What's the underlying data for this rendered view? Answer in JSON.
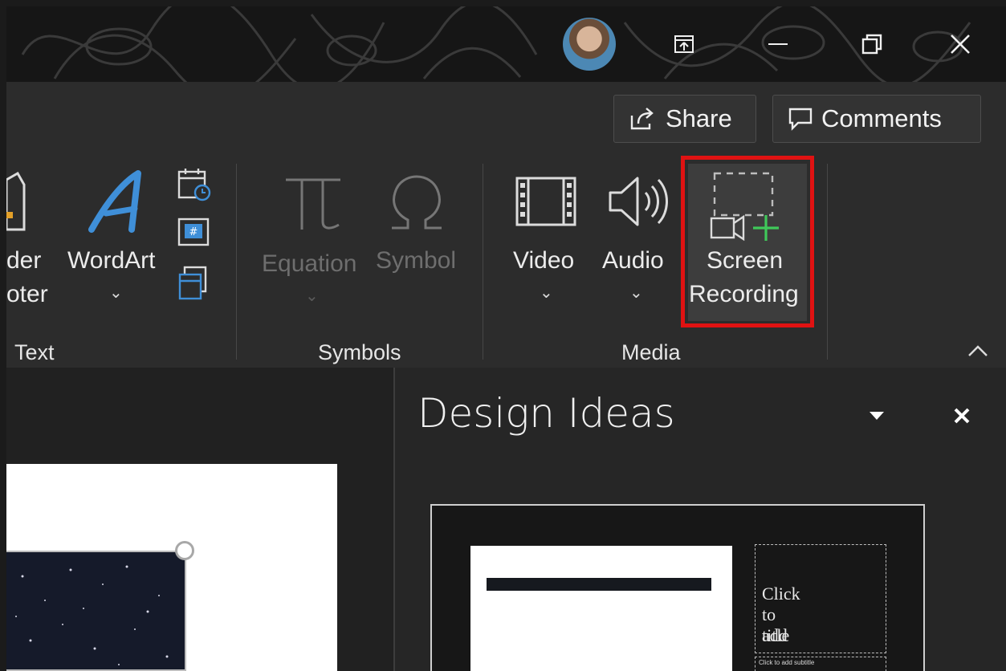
{
  "window": {
    "user_avatar": "user-avatar",
    "controls": [
      "ribbon-display-options-icon",
      "minimize-icon",
      "restore-icon",
      "close-icon"
    ]
  },
  "header": {
    "share_label": "Share",
    "comments_label": "Comments"
  },
  "ribbon": {
    "text_group": {
      "label": "Text",
      "header_footer_lines": [
        "der",
        "oter"
      ],
      "wordart_label": "WordArt"
    },
    "symbols_group": {
      "label": "Symbols",
      "equation_label": "Equation",
      "symbol_label": "Symbol"
    },
    "media_group": {
      "label": "Media",
      "video_label": "Video",
      "audio_label": "Audio",
      "screen_recording_lines": [
        "Screen",
        "Recording"
      ]
    },
    "highlight_color": "#e01212"
  },
  "design_ideas": {
    "title": "Design Ideas",
    "preview": {
      "title_placeholder_lines": [
        "Click to add",
        "title"
      ],
      "subtitle_placeholder": "Click to add subtitle"
    }
  }
}
